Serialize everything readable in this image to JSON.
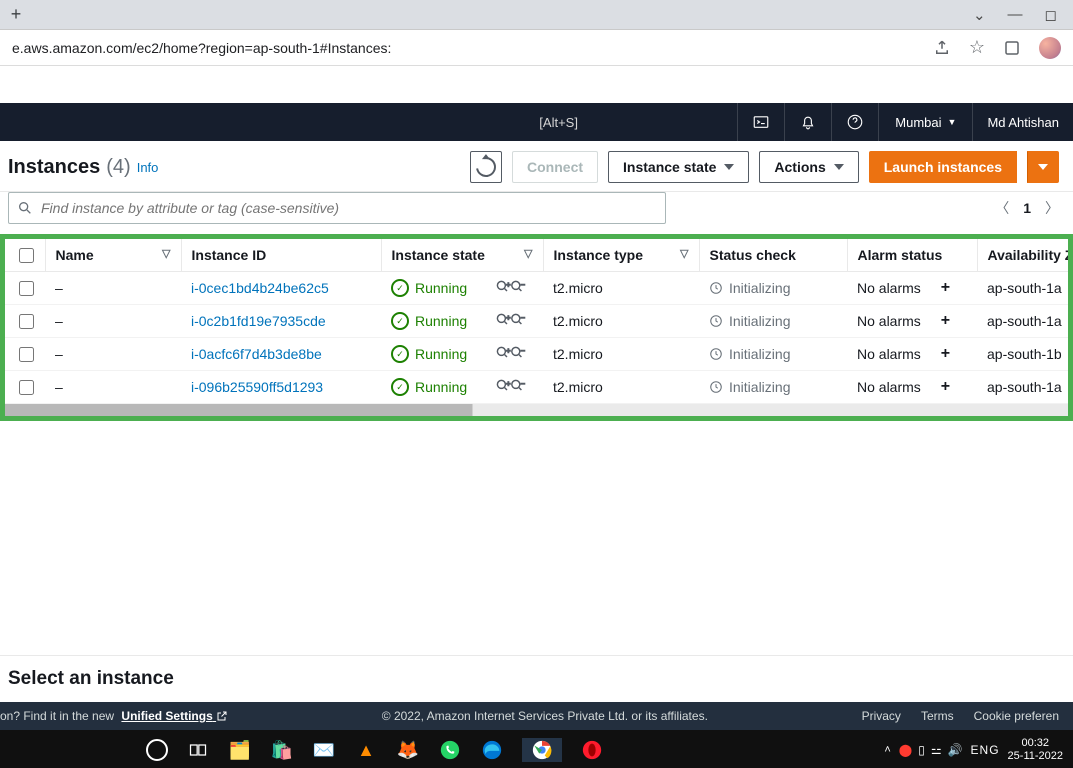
{
  "browser": {
    "url": "e.aws.amazon.com/ec2/home?region=ap-south-1#Instances:"
  },
  "awsNav": {
    "shortcutHint": "[Alt+S]",
    "region": "Mumbai",
    "user": "Md Ahtishan"
  },
  "header": {
    "title": "Instances",
    "count": "(4)",
    "infoLabel": "Info"
  },
  "buttons": {
    "connect": "Connect",
    "instanceState": "Instance state",
    "actions": "Actions",
    "launch": "Launch instances"
  },
  "search": {
    "placeholder": "Find instance by attribute or tag (case-sensitive)"
  },
  "pager": {
    "page": "1"
  },
  "columns": {
    "name": "Name",
    "instanceId": "Instance ID",
    "instanceState": "Instance state",
    "instanceType": "Instance type",
    "statusCheck": "Status check",
    "alarmStatus": "Alarm status",
    "az": "Availability Z"
  },
  "rows": [
    {
      "name": "–",
      "id": "i-0cec1bd4b24be62c5",
      "state": "Running",
      "type": "t2.micro",
      "status": "Initializing",
      "alarm": "No alarms",
      "az": "ap-south-1a"
    },
    {
      "name": "–",
      "id": "i-0c2b1fd19e7935cde",
      "state": "Running",
      "type": "t2.micro",
      "status": "Initializing",
      "alarm": "No alarms",
      "az": "ap-south-1a"
    },
    {
      "name": "–",
      "id": "i-0acfc6f7d4b3de8be",
      "state": "Running",
      "type": "t2.micro",
      "status": "Initializing",
      "alarm": "No alarms",
      "az": "ap-south-1b"
    },
    {
      "name": "–",
      "id": "i-096b25590ff5d1293",
      "state": "Running",
      "type": "t2.micro",
      "status": "Initializing",
      "alarm": "No alarms",
      "az": "ap-south-1a"
    }
  ],
  "detail": {
    "title": "Select an instance"
  },
  "footer": {
    "leftPrefix": "on? Find it in the new",
    "leftLink": "Unified Settings",
    "copyright": "© 2022, Amazon Internet Services Private Ltd. or its affiliates.",
    "privacy": "Privacy",
    "terms": "Terms",
    "cookie": "Cookie preferen"
  },
  "taskbar": {
    "lang": "ENG",
    "time": "00:32",
    "date": "25-11-2022"
  }
}
